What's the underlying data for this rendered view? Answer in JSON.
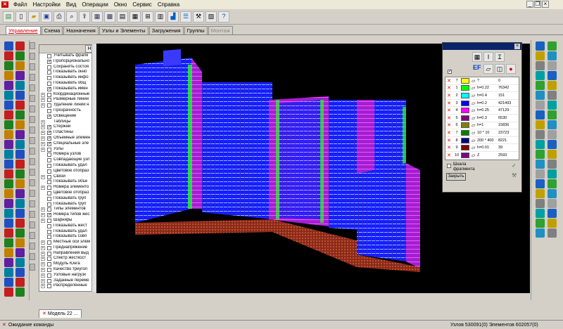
{
  "menu": {
    "items": [
      "Файл",
      "Настройки",
      "Вид",
      "Операции",
      "Окно",
      "Сервис",
      "Справка"
    ]
  },
  "tabs": [
    {
      "label": "Управление",
      "state": "active"
    },
    {
      "label": "Схема",
      "state": "normal"
    },
    {
      "label": "Назначения",
      "state": "normal"
    },
    {
      "label": "Узлы и Элементы",
      "state": "normal"
    },
    {
      "label": "Загружения",
      "state": "normal"
    },
    {
      "label": "Группы",
      "state": "normal"
    },
    {
      "label": "Монтаж",
      "state": "disabled"
    }
  ],
  "left_panel": {
    "header_btn": "H",
    "items": [
      {
        "label": "Учитывать фрагм",
        "checked": false,
        "expand": false
      },
      {
        "label": "Пропорционально",
        "checked": true,
        "expand": false
      },
      {
        "label": "Сохранять состоя",
        "checked": false,
        "expand": false
      },
      {
        "label": "Показывать окно",
        "checked": false,
        "expand": false
      },
      {
        "label": "Показывать инфо",
        "checked": false,
        "expand": false
      },
      {
        "label": "Показывать общ",
        "checked": false,
        "expand": false
      },
      {
        "label": "Показывать имен",
        "checked": true,
        "expand": false
      },
      {
        "label": "Координационные",
        "checked": false,
        "expand": true
      },
      {
        "label": "Размерные линии",
        "checked": false,
        "expand": true
      },
      {
        "label": "Удаление линий н",
        "checked": false,
        "expand": true
      },
      {
        "label": "Прозрачность",
        "checked": false,
        "expand": false
      },
      {
        "label": "Освещение",
        "checked": true,
        "expand": false
      },
      {
        "label": "Таблицы",
        "checked": null,
        "expand": true
      },
      {
        "label": "Стержни",
        "checked": true,
        "expand": true
      },
      {
        "label": "Пластины",
        "checked": true,
        "expand": true
      },
      {
        "label": "Объемные элемен",
        "checked": true,
        "expand": true
      },
      {
        "label": "Специальные эле",
        "checked": true,
        "expand": true
      },
      {
        "label": "Узлы",
        "checked": false,
        "expand": true
      },
      {
        "label": "Номера узлов",
        "checked": false,
        "expand": false
      },
      {
        "label": "Совпадающие узл",
        "checked": false,
        "expand": false
      },
      {
        "label": "Показывать удал",
        "checked": false,
        "expand": false
      },
      {
        "label": "Цветовое отобраз",
        "checked": false,
        "expand": false
      },
      {
        "label": "Связи",
        "checked": false,
        "expand": true
      },
      {
        "label": "Показывать объе",
        "checked": false,
        "expand": false
      },
      {
        "label": "Номера элементо",
        "checked": false,
        "expand": true
      },
      {
        "label": "Цветовое отобраз",
        "checked": false,
        "expand": false
      },
      {
        "label": "Показывать груп",
        "checked": false,
        "expand": false
      },
      {
        "label": "Показывать груп",
        "checked": false,
        "expand": false
      },
      {
        "label": "Типы элементов",
        "checked": false,
        "expand": true
      },
      {
        "label": "Номера типов жес",
        "checked": true,
        "expand": true
      },
      {
        "label": "Шарниры",
        "checked": false,
        "expand": true
      },
      {
        "label": "Показывать жест",
        "checked": false,
        "expand": false
      },
      {
        "label": "Показывать удал",
        "checked": false,
        "expand": false
      },
      {
        "label": "Показывать совп",
        "checked": false,
        "expand": false
      },
      {
        "label": "Местные оси элем",
        "checked": false,
        "expand": true
      },
      {
        "label": "Преднапряжение",
        "checked": false,
        "expand": true
      },
      {
        "label": "Направления выд",
        "checked": false,
        "expand": true
      },
      {
        "label": "Спектр жесткост",
        "checked": false,
        "expand": true
      },
      {
        "label": "Модуль Юнга",
        "checked": false,
        "expand": true
      },
      {
        "label": "Качество треугол",
        "checked": false,
        "expand": true
      },
      {
        "label": "Узловые нагрузк",
        "checked": false,
        "expand": true
      },
      {
        "label": "Заданные переме",
        "checked": false,
        "expand": true
      },
      {
        "label": "Распределенные",
        "checked": false,
        "expand": true
      }
    ]
  },
  "dialog": {
    "header_icons": [
      "grid-icon",
      "i-beam-icon",
      "section-icon",
      "ef-icon",
      "plates-icon",
      "box-icon",
      "paint-icon",
      "stop-icon"
    ],
    "header_label": "EF",
    "rows": [
      {
        "num": "?",
        "color": "#ffff00",
        "label": "?",
        "count": "0"
      },
      {
        "num": "1",
        "color": "#00ff00",
        "label": "h=0.22",
        "count": "76342"
      },
      {
        "num": "2",
        "color": "#00ffff",
        "label": "h=0.4",
        "count": "151"
      },
      {
        "num": "3",
        "color": "#0000ff",
        "label": "h=0.2",
        "count": "421493"
      },
      {
        "num": "4",
        "color": "#ff00ff",
        "label": "h=0.25",
        "count": "47129"
      },
      {
        "num": "5",
        "color": "#800080",
        "label": "h=0.3",
        "count": "6530"
      },
      {
        "num": "6",
        "color": "#808000",
        "label": "h=1",
        "count": "15836"
      },
      {
        "num": "7",
        "color": "#008000",
        "label": "10 * 10",
        "count": "23723"
      },
      {
        "num": "8",
        "color": "#000080",
        "label": "200 * 400",
        "count": "8221"
      },
      {
        "num": "9",
        "color": "#800000",
        "label": "h=0.01",
        "count": "39"
      },
      {
        "num": "10",
        "color": "#800080",
        "label": "Z",
        "count": "2593"
      }
    ],
    "scale_label": "Шкала",
    "fragment_label": "фрагмента",
    "close_label": "Закрыть"
  },
  "document_tab": "Модель 22 ...",
  "status": {
    "message": "Ожидание команды",
    "counts": "Узлов 530091(0) Элементов 602057(0)"
  }
}
